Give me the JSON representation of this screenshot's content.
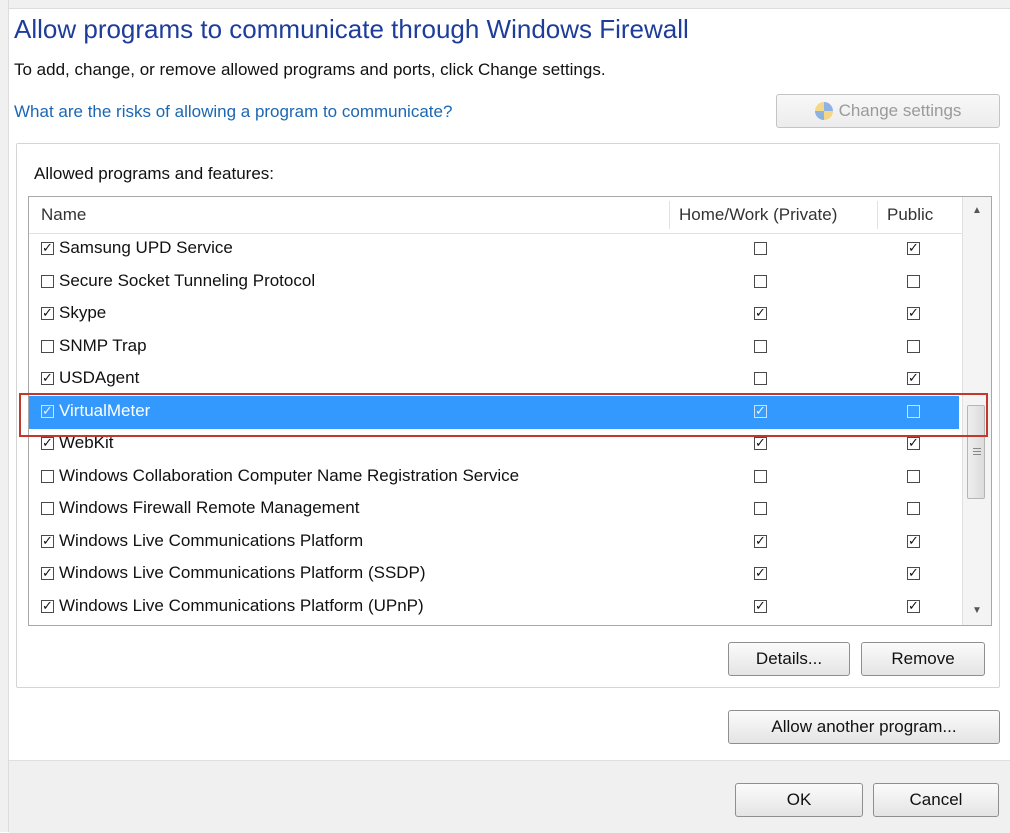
{
  "header": {
    "title": "Allow programs to communicate through Windows Firewall",
    "subtitle": "To add, change, or remove allowed programs and ports, click Change settings.",
    "risk_link": "What are the risks of allowing a program to communicate?",
    "change_settings_label": "Change settings"
  },
  "group": {
    "label": "Allowed programs and features:"
  },
  "table": {
    "columns": {
      "name": "Name",
      "home": "Home/Work (Private)",
      "public": "Public"
    },
    "rows": [
      {
        "name": "Samsung UPD Service",
        "enabled": true,
        "home": false,
        "public": true
      },
      {
        "name": "Secure Socket Tunneling Protocol",
        "enabled": false,
        "home": false,
        "public": false
      },
      {
        "name": "Skype",
        "enabled": true,
        "home": true,
        "public": true
      },
      {
        "name": "SNMP Trap",
        "enabled": false,
        "home": false,
        "public": false
      },
      {
        "name": "USDAgent",
        "enabled": true,
        "home": false,
        "public": true
      },
      {
        "name": "VirtualMeter",
        "enabled": true,
        "home": true,
        "public": false,
        "selected": true
      },
      {
        "name": "WebKit",
        "enabled": true,
        "home": true,
        "public": true
      },
      {
        "name": "Windows Collaboration Computer Name Registration Service",
        "enabled": false,
        "home": false,
        "public": false
      },
      {
        "name": "Windows Firewall Remote Management",
        "enabled": false,
        "home": false,
        "public": false
      },
      {
        "name": "Windows Live Communications Platform",
        "enabled": true,
        "home": true,
        "public": true
      },
      {
        "name": "Windows Live Communications Platform (SSDP)",
        "enabled": true,
        "home": true,
        "public": true
      },
      {
        "name": "Windows Live Communications Platform (UPnP)",
        "enabled": true,
        "home": true,
        "public": true
      }
    ]
  },
  "buttons": {
    "details": "Details...",
    "remove": "Remove",
    "allow_another": "Allow another program...",
    "ok": "OK",
    "cancel": "Cancel"
  },
  "icons": {
    "check_glyph": "✓",
    "scroll_up": "▲",
    "scroll_down": "▼"
  },
  "colors": {
    "title": "#1e3d9b",
    "link": "#1c67b3",
    "selection": "#3399ff",
    "highlight_box": "#c0392b"
  }
}
